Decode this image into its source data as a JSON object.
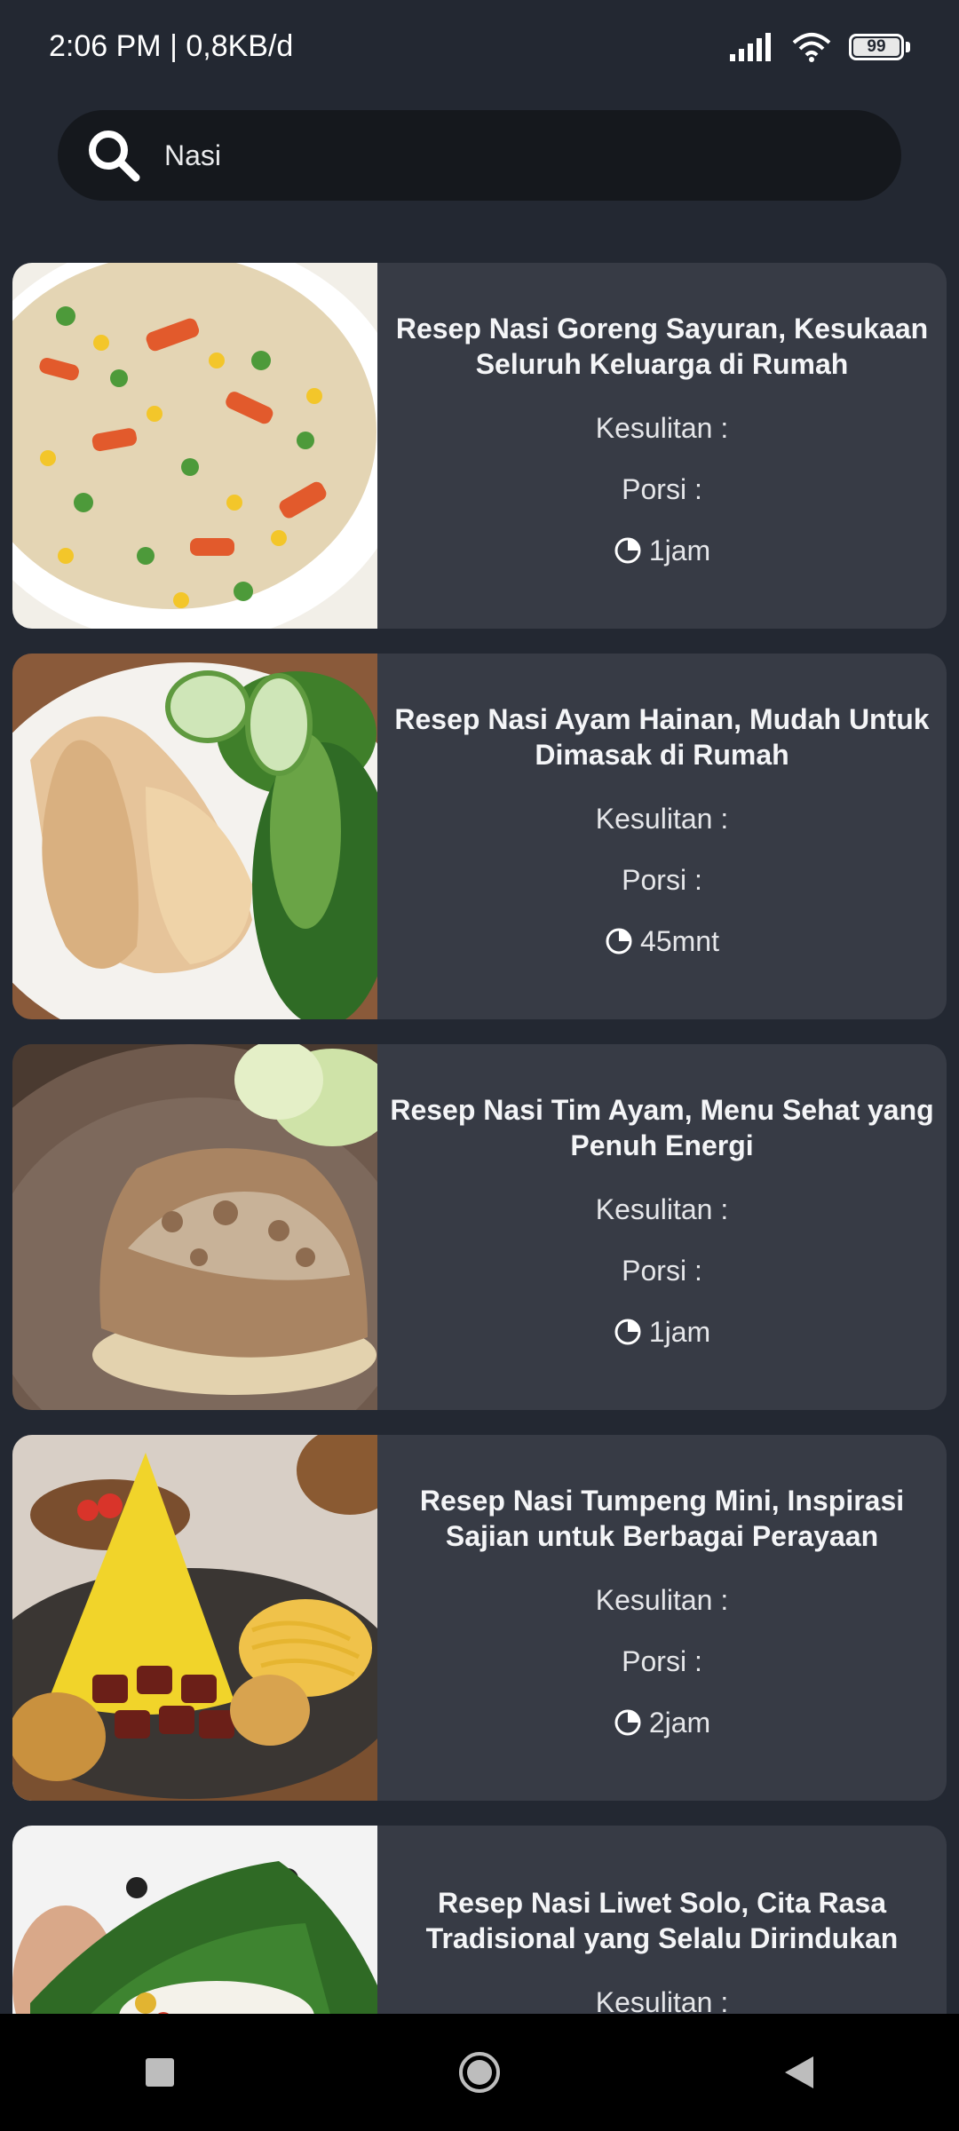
{
  "status_bar": {
    "time": "2:06 PM | 0,8KB/d",
    "battery": "99"
  },
  "search": {
    "icon": "search-icon",
    "value": "Nasi"
  },
  "recipes": [
    {
      "title": "Resep Nasi Goreng Sayuran, Kesukaan Seluruh Keluarga di Rumah",
      "difficulty": "Kesulitan :",
      "portion": "Porsi :",
      "time": "1jam",
      "image": "fried-rice-vegetables"
    },
    {
      "title": "Resep Nasi Ayam Hainan, Mudah Untuk Dimasak di Rumah",
      "difficulty": "Kesulitan :",
      "portion": "Porsi :",
      "time": "45mnt",
      "image": "hainan-chicken"
    },
    {
      "title": "Resep Nasi Tim Ayam, Menu Sehat yang Penuh Energi",
      "difficulty": "Kesulitan :",
      "portion": "Porsi :",
      "time": "1jam",
      "image": "nasi-tim-ayam"
    },
    {
      "title": "Resep Nasi Tumpeng Mini, Inspirasi Sajian untuk Berbagai Perayaan",
      "difficulty": "Kesulitan :",
      "portion": "Porsi :",
      "time": "2jam",
      "image": "tumpeng-mini"
    },
    {
      "title": "Resep Nasi Liwet Solo, Cita Rasa Tradisional yang Selalu Dirindukan",
      "difficulty": "Kesulitan :",
      "portion": "",
      "time": "",
      "image": "nasi-liwet"
    }
  ],
  "nav": {
    "recents": "square-icon",
    "home": "circle-icon",
    "back": "triangle-back-icon"
  }
}
